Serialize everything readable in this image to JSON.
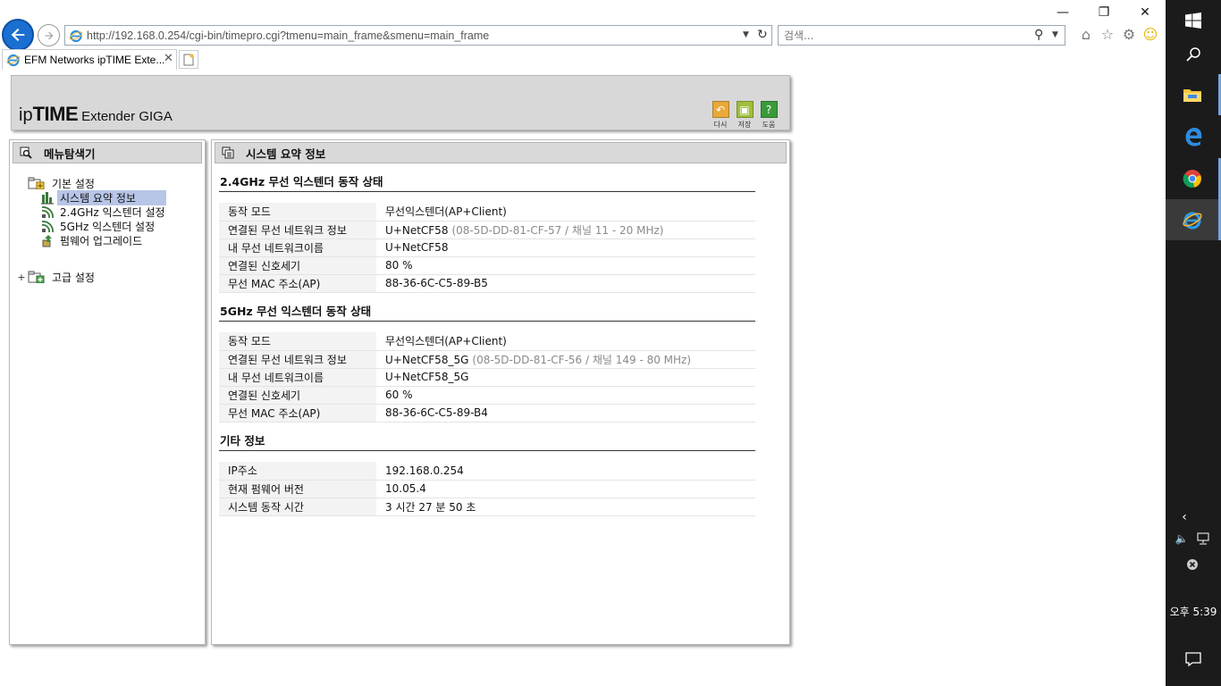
{
  "browser": {
    "url": "http://192.168.0.254/cgi-bin/timepro.cgi?tmenu=main_frame&smenu=main_frame",
    "search_placeholder": "검색...",
    "tab_title": "EFM Networks ipTIME Exte...",
    "tab_close": "✕",
    "window_controls": {
      "minimize": "—",
      "restore": "❐",
      "close": "✕"
    }
  },
  "header": {
    "logo_ip": "ip",
    "logo_time": "TIME",
    "logo_product": "Extender GIGA",
    "buttons": [
      {
        "label": "다시",
        "icon": "refresh-icon",
        "color": "#e8a93a",
        "glyph": "↶"
      },
      {
        "label": "저장",
        "icon": "save-icon",
        "color": "#9fbf3a",
        "glyph": "▣"
      },
      {
        "label": "도움",
        "icon": "help-icon",
        "color": "#3a9a3a",
        "glyph": "?"
      }
    ]
  },
  "left_panel": {
    "title": "메뉴탐색기",
    "tree": [
      {
        "label": "기본 설정",
        "expanded": true,
        "children": [
          {
            "label": "시스템 요약 정보",
            "icon": "chart-icon",
            "selected": true
          },
          {
            "label": "2.4GHz 익스텐더 설정",
            "icon": "wifi-icon",
            "selected": false
          },
          {
            "label": "5GHz 익스텐더 설정",
            "icon": "wifi-icon",
            "selected": false
          },
          {
            "label": "펌웨어 업그레이드",
            "icon": "upgrade-icon",
            "selected": false
          }
        ]
      },
      {
        "label": "고급 설정",
        "expanded": false,
        "expander": "+"
      }
    ]
  },
  "main_panel": {
    "title": "시스템 요약 정보",
    "sections": [
      {
        "title": "2.4GHz 무선 익스텐더 동작 상태",
        "rows": [
          {
            "key": "동작 모드",
            "value": "무선익스텐더(AP+Client)",
            "sub": ""
          },
          {
            "key": "연결된 무선 네트워크 정보",
            "value": "U+NetCF58",
            "sub": "(08-5D-DD-81-CF-57 / 채널 11 - 20 MHz)"
          },
          {
            "key": "내 무선 네트워크이름",
            "value": "U+NetCF58",
            "sub": ""
          },
          {
            "key": "연결된 신호세기",
            "value": "80 %",
            "sub": ""
          },
          {
            "key": "무선 MAC 주소(AP)",
            "value": "88-36-6C-C5-89-B5",
            "sub": ""
          }
        ]
      },
      {
        "title": "5GHz 무선 익스텐더 동작 상태",
        "rows": [
          {
            "key": "동작 모드",
            "value": "무선익스텐더(AP+Client)",
            "sub": ""
          },
          {
            "key": "연결된 무선 네트워크 정보",
            "value": "U+NetCF58_5G",
            "sub": "(08-5D-DD-81-CF-56 / 채널 149 - 80 MHz)"
          },
          {
            "key": "내 무선 네트워크이름",
            "value": "U+NetCF58_5G",
            "sub": ""
          },
          {
            "key": "연결된 신호세기",
            "value": "60 %",
            "sub": ""
          },
          {
            "key": "무선 MAC 주소(AP)",
            "value": "88-36-6C-C5-89-B4",
            "sub": ""
          }
        ]
      },
      {
        "title": "기타 정보",
        "rows": [
          {
            "key": "IP주소",
            "value": "192.168.0.254",
            "sub": ""
          },
          {
            "key": "현재 펌웨어 버전",
            "value": "10.05.4",
            "sub": ""
          },
          {
            "key": "시스템 동작 시간",
            "value": "3 시간 27 분 50 초",
            "sub": ""
          }
        ]
      }
    ]
  },
  "taskbar": {
    "clock": "오후 5:39",
    "apps": [
      "windows-start-icon",
      "search-icon",
      "file-explorer-icon",
      "edge-icon",
      "chrome-icon",
      "internet-explorer-icon"
    ],
    "accent": "#76a6e0"
  }
}
